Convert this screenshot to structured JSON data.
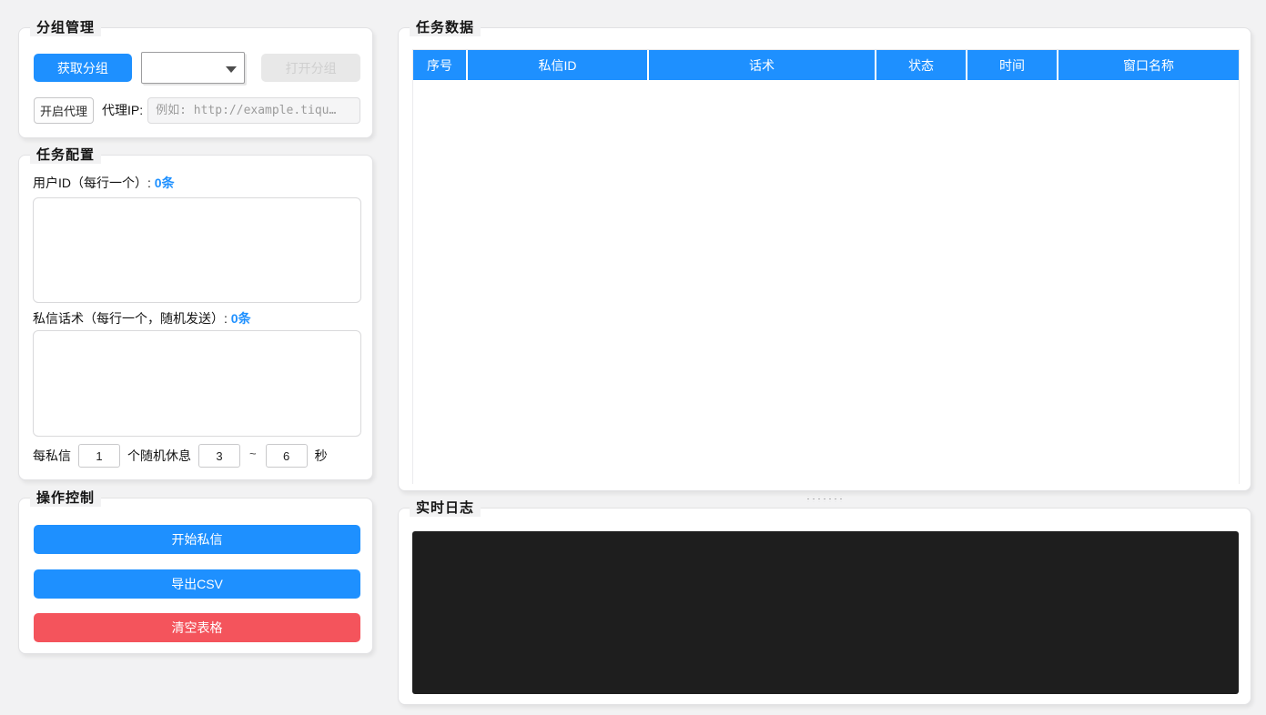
{
  "app": {
    "accent_blue": "#1e90ff",
    "accent_red": "#f4545c",
    "log_bg": "#1e1e1e",
    "page_bg": "#f2f2f3"
  },
  "group_management": {
    "title": "分组管理",
    "get_groups_button": "获取分组",
    "group_dropdown_value": "",
    "open_group_button": "打开分组",
    "enable_proxy_button": "开启代理",
    "proxy_ip_label": "代理IP:",
    "proxy_ip_value": "",
    "proxy_ip_placeholder": "例如: http://example.tiqu…"
  },
  "task_config": {
    "title": "任务配置",
    "user_id_label": "用户ID（每行一个）: ",
    "user_id_count": "0条",
    "user_id_value": "",
    "script_label": "私信话术（每行一个，随机发送）: ",
    "script_count": "0条",
    "script_value": "",
    "interval": {
      "prefix": "每私信",
      "per_count": "1",
      "middle": "个随机休息",
      "min_seconds": "3",
      "tilde": "~",
      "max_seconds": "6",
      "suffix": "秒"
    }
  },
  "operation_control": {
    "title": "操作控制",
    "start_button": "开始私信",
    "export_button": "导出CSV",
    "clear_button": "清空表格"
  },
  "task_data": {
    "title": "任务数据",
    "columns": [
      "序号",
      "私信ID",
      "话术",
      "状态",
      "时间",
      "窗口名称"
    ],
    "rows": []
  },
  "log": {
    "title": "实时日志",
    "content": ""
  }
}
